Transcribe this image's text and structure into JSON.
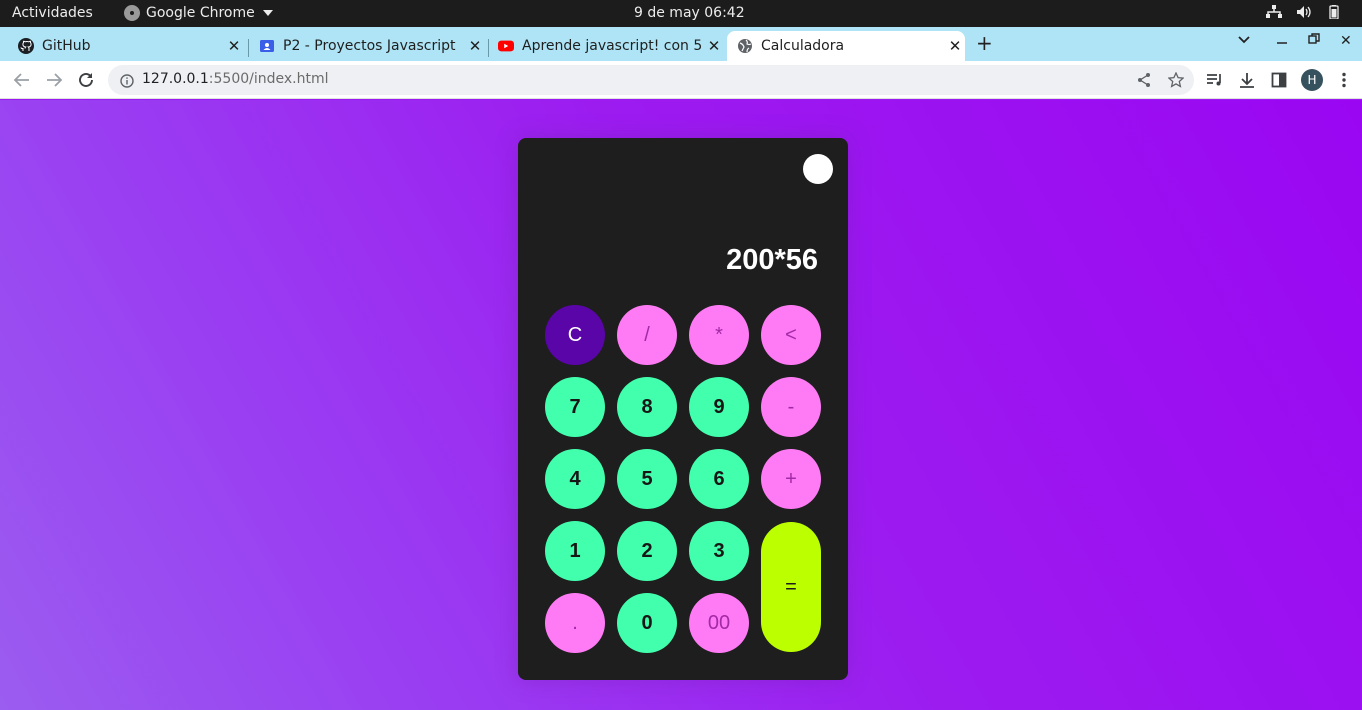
{
  "system_bar": {
    "activities": "Actividades",
    "app_name": "Google Chrome",
    "clock": "9 de may  06:42"
  },
  "tabs": [
    {
      "title": "GitHub",
      "icon": "github-icon"
    },
    {
      "title": "P2 - Proyectos Javascript",
      "icon": "classroom-icon"
    },
    {
      "title": "Aprende javascript! con 5",
      "icon": "youtube-icon"
    },
    {
      "title": "Calculadora",
      "icon": "globe-icon",
      "active": true
    }
  ],
  "address_bar": {
    "host": "127.0.0.1",
    "path": ":5500/index.html"
  },
  "profile": {
    "initial": "H"
  },
  "calculator": {
    "display": "200*56",
    "keys": {
      "clear": "C",
      "divide": "/",
      "multiply": "*",
      "backspace": "<",
      "seven": "7",
      "eight": "8",
      "nine": "9",
      "minus": "-",
      "four": "4",
      "five": "5",
      "six": "6",
      "plus": "+",
      "one": "1",
      "two": "2",
      "three": "3",
      "equals": "=",
      "dot": ".",
      "zero": "0",
      "double_zero": "00"
    }
  },
  "colors": {
    "page_gradient": [
      "#9b5cf0",
      "#9a06f2"
    ],
    "calc_body": "#1e1e1e",
    "number_key": "#41ffac",
    "operator_key": "#ff7bf5",
    "clear_key": "#5a05a8",
    "equals_key": "#bcff00",
    "tab_strip": "#aee4f5"
  }
}
